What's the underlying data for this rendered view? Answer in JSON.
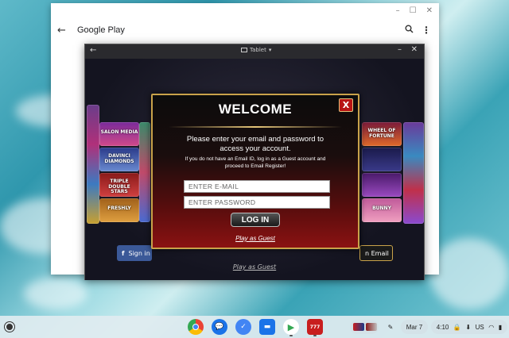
{
  "google_play": {
    "title": "Google Play",
    "window_controls": [
      "–",
      "☐",
      "✕"
    ]
  },
  "game_window": {
    "view_mode": "Tablet",
    "background_buttons": {
      "facebook_label": "Sign in",
      "email_label": "n Email"
    },
    "background_guest": "Play as Guest",
    "tiles": [
      {
        "label": "SALON MEDIA"
      },
      {
        "label": "DAVINCI DIAMONDS"
      },
      {
        "label": "TRIPLE DOUBLE STARS"
      },
      {
        "label": "FRESHLY"
      },
      {
        "label": "WHEEL OF FORTUNE"
      },
      {
        "label": "BUNNY"
      }
    ]
  },
  "modal": {
    "title": "WELCOME",
    "close": "X",
    "line1": "Please enter your email and password to",
    "line2": "access your account.",
    "note1": "If you do not have an Email ID, log in as a Guest account and",
    "note2": "proceed to Email Register!",
    "email_placeholder": "ENTER E-MAIL",
    "password_placeholder": "ENTER PASSWORD",
    "login_label": "LOG IN",
    "guest_link": "Play as Guest"
  },
  "shelf": {
    "apps": [
      "chrome",
      "messages",
      "calendar",
      "files",
      "play-store",
      "slots-app"
    ],
    "date": "Mar 7",
    "time": "4:10",
    "input_method": "US"
  },
  "colors": {
    "modal_border": "#c9a24a",
    "close_button": "#b81414",
    "facebook_blue": "#3b5998"
  }
}
